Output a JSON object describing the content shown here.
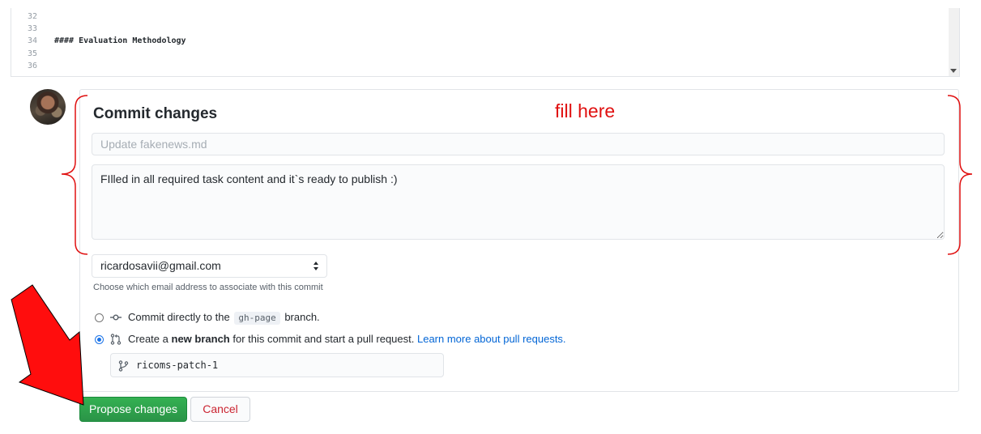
{
  "editor": {
    "lines": [
      {
        "num": "32",
        "code": ""
      },
      {
        "num": "33",
        "code": ""
      },
      {
        "num": "34",
        "code": "#### Evaluation Methodology"
      },
      {
        "num": "35",
        "code": ""
      },
      {
        "num": "36",
        "code": ""
      }
    ]
  },
  "commit": {
    "title": "Commit changes",
    "summary_placeholder": "Update fakenews.md",
    "summary_value": "",
    "description_value": "FIlled in all required task content and it`s ready to publish :)",
    "email_selected": "ricardosavii@gmail.com",
    "email_hint": "Choose which email address to associate with this commit",
    "option_direct": {
      "prefix": "Commit directly to the",
      "branch": "gh-page",
      "suffix": "branch.",
      "checked": false
    },
    "option_new_branch": {
      "prefix": "Create a",
      "bold": "new branch",
      "suffix": "for this commit and start a pull request.",
      "link": "Learn more about pull requests.",
      "checked": true
    },
    "branch_name": "ricoms-patch-1"
  },
  "buttons": {
    "propose": "Propose changes",
    "cancel": "Cancel"
  },
  "annotation": {
    "text": "fill here",
    "color": "#e01010"
  },
  "colors": {
    "primary_button": "#2ea44f",
    "link": "#0366d6",
    "cancel_text": "#cb2431"
  }
}
